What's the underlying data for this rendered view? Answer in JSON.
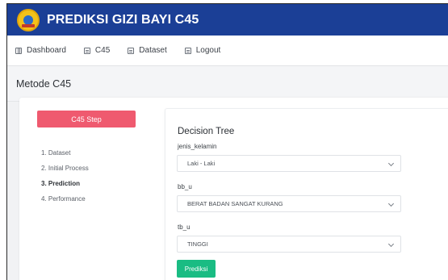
{
  "app": {
    "title": "PREDIKSI GIZI BAYI C45",
    "logo_icon": "logo-icon"
  },
  "colors": {
    "topbar": "#1b3f96",
    "step_button": "#ef5a6f",
    "predict_button": "#1abc83"
  },
  "nav": {
    "items": [
      {
        "label": "Dashboard",
        "icon": "grid-icon"
      },
      {
        "label": "C45",
        "icon": "document-icon"
      },
      {
        "label": "Dataset",
        "icon": "document-icon"
      },
      {
        "label": "Logout",
        "icon": "document-icon"
      }
    ]
  },
  "page": {
    "title": "Metode C45"
  },
  "sidebar": {
    "step_button": "C45 Step",
    "steps": [
      {
        "label": "1. Dataset",
        "active": false
      },
      {
        "label": "2. Initial Process",
        "active": false
      },
      {
        "label": "3. Prediction",
        "active": true
      },
      {
        "label": "4. Performance",
        "active": false
      }
    ]
  },
  "form": {
    "title": "Decision Tree",
    "fields": [
      {
        "label": "jenis_kelamin",
        "value": "Laki - Laki"
      },
      {
        "label": "bb_u",
        "value": "BERAT BADAN SANGAT KURANG"
      },
      {
        "label": "tb_u",
        "value": "TINGGI"
      }
    ],
    "submit_label": "Prediksi"
  }
}
